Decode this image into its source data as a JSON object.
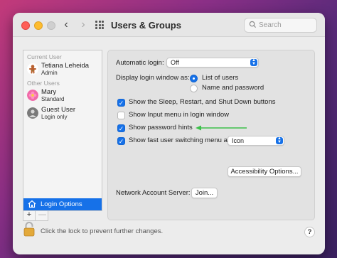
{
  "window": {
    "title": "Users & Groups",
    "search_placeholder": "Search"
  },
  "sidebar": {
    "current_user_label": "Current User",
    "current_user": {
      "name": "Tetiana Leheida",
      "role": "Admin"
    },
    "other_users_label": "Other Users",
    "other_users": [
      {
        "name": "Mary",
        "role": "Standard"
      },
      {
        "name": "Guest User",
        "role": "Login only"
      }
    ],
    "login_options_label": "Login Options",
    "add_label": "+",
    "remove_label": "—"
  },
  "panel": {
    "automatic_login": {
      "label": "Automatic login:",
      "value": "Off"
    },
    "display_window": {
      "label": "Display login window as:",
      "options": [
        "List of users",
        "Name and password"
      ],
      "selected": "List of users"
    },
    "checkboxes": [
      {
        "label": "Show the Sleep, Restart, and Shut Down buttons",
        "checked": true
      },
      {
        "label": "Show Input menu in login window",
        "checked": false
      },
      {
        "label": "Show password hints",
        "checked": true
      },
      {
        "label": "Show fast user switching menu as",
        "checked": true
      }
    ],
    "fast_switch_value": "Icon",
    "accessibility_button": "Accessibility Options...",
    "network_label": "Network Account Server:",
    "join_button": "Join..."
  },
  "footer": {
    "lock_text": "Click the lock to prevent further changes.",
    "help_label": "?"
  },
  "colors": {
    "accent": "#1671e8",
    "arrow": "#3cc04a"
  }
}
